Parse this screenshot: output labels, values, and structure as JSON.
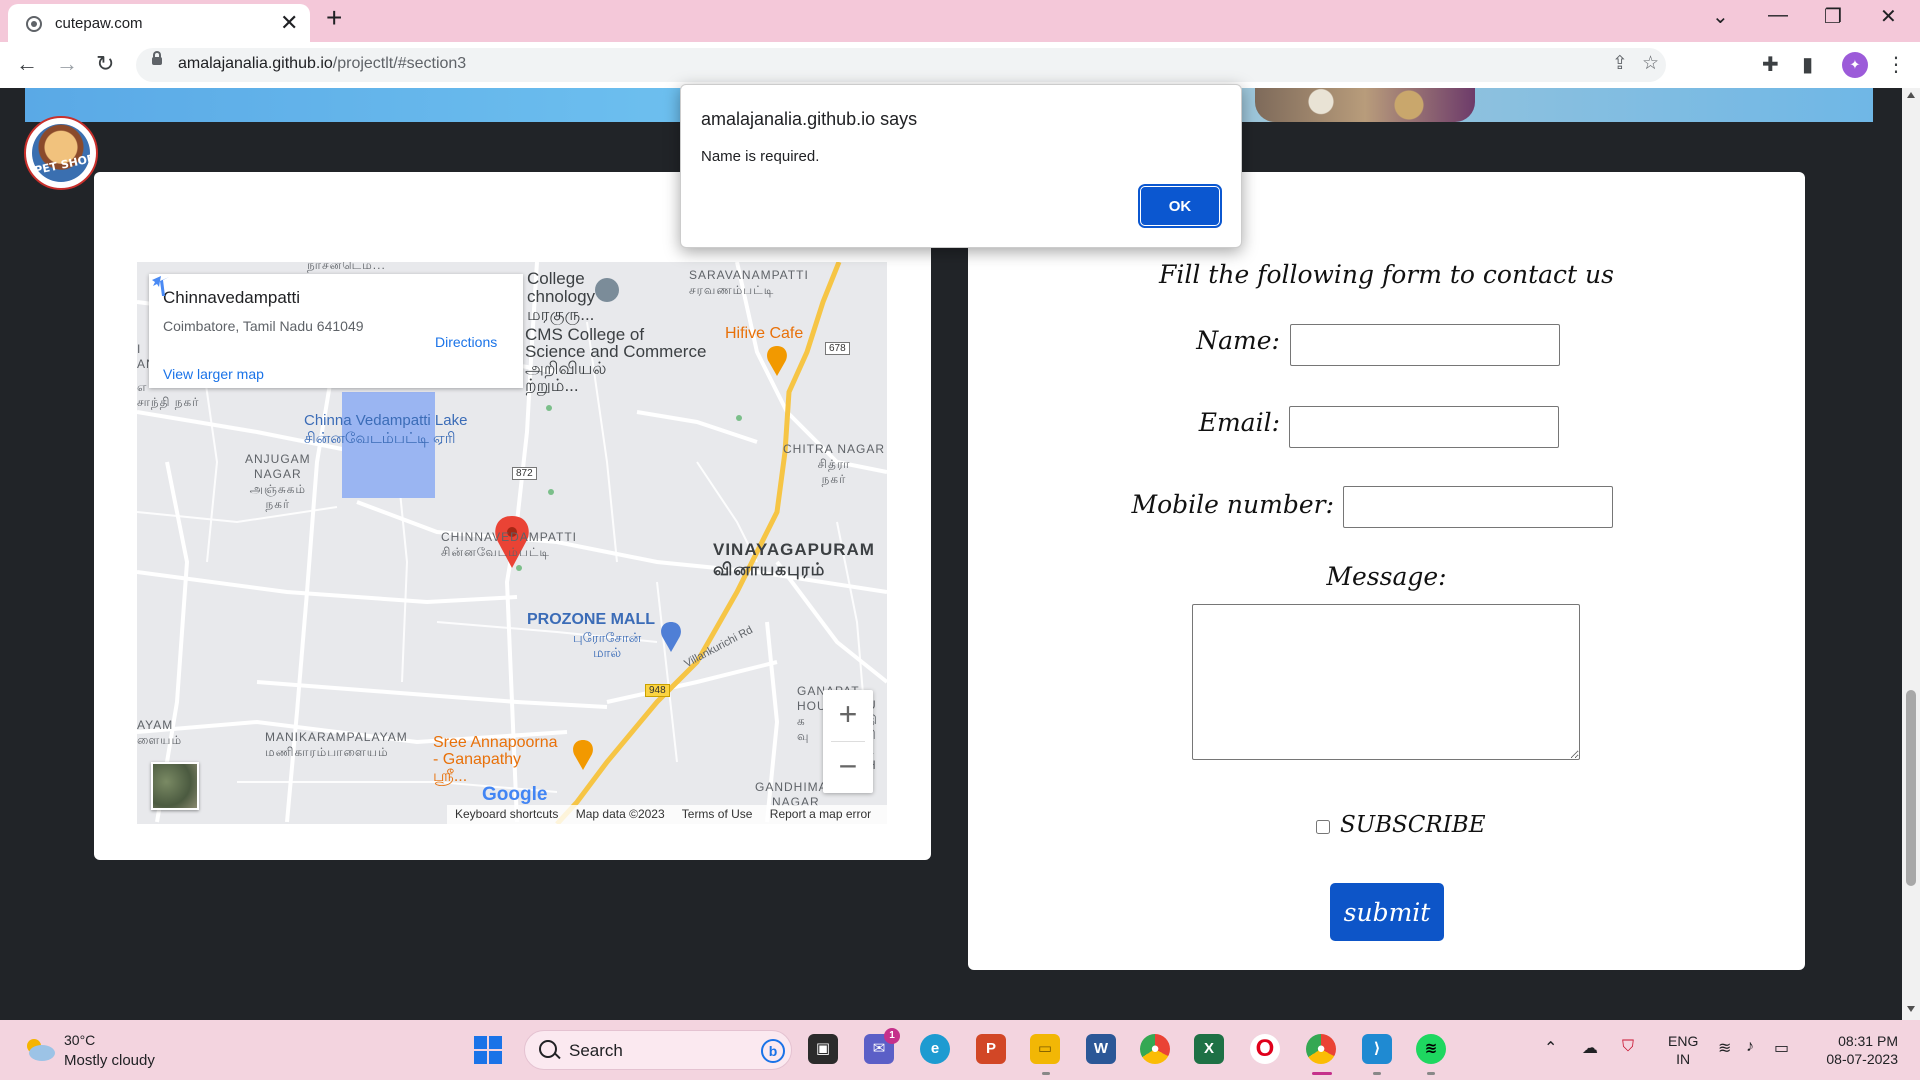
{
  "browser": {
    "tab_title": "cutepaw.com",
    "tab_close": "✕",
    "new_tab": "+",
    "url_domain": "amalajanalia.github.io",
    "url_path": "/projectlt/#section3",
    "window_controls": [
      "⌄",
      "—",
      "❐",
      "✕"
    ]
  },
  "logo": {
    "text": "PET SHOP"
  },
  "map": {
    "place_name": "Chinnavedampatti",
    "address": "Coimbatore, Tamil Nadu 641049",
    "directions_label": "Directions",
    "larger_map_link": "View larger map",
    "labels": {
      "saravanampatti": "SARAVANAMPATTI\nசரவணம்பட்டி",
      "college": "College\nchnology\nமரகுரு...",
      "cms": "CMS College of\nScience and Commerce\nஅறிவியல்\nற்றும்...",
      "hifive": "Hifive Cafe",
      "lake": "Chinna Vedampatti Lake\nசின்னவேடம்பட்டி ஏரி",
      "anjugam": "ANJUGAM\nNAGAR\nஅஞ்சுகம்\nநகர்",
      "chitra": "CHITRA NAGAR\nசித்ரா\nநகர்",
      "chinnavedampatti": "CHINNAVEDAMPATTI\nசின்னவேடம்பட்டி",
      "vinayagapuram": "VINAYAGAPURAM\nவினாயகபுரம்",
      "prozone": "PROZONE MALL",
      "prozone_ta": "புரோசோன்\nமால்",
      "villankurichi": "Villankurichi Rd",
      "ganapathy_hou": "GANAPAT\nHOU\nக\nவு",
      "ayam": "AYAM\nளையம்",
      "manikarampalayam": "MANIKARAMPALAYAM\nமணிகாரம்பாளையம்",
      "annapoorna": "Sree Annapoorna\n- Ganapathy\nஸ்ரீ...",
      "gandhimaa": "GANDHIMAA\nNAGAR",
      "santhi": "எ\nசாந்தி நகர்",
      "an": "I\nAN",
      "top_left": "நாசன்டெம்...",
      "r678": "678",
      "r872": "872",
      "r948": "948",
      "right_chars": "U\nதி\nரி\nL\nH"
    },
    "google_logo": "Google",
    "zoom_in": "+",
    "zoom_out": "−",
    "attribution": [
      "Keyboard shortcuts",
      "Map data ©2023",
      "Terms of Use",
      "Report a map error"
    ]
  },
  "form": {
    "heading": "Fill the following form to contact us",
    "name_label": "Name:",
    "email_label": "Email:",
    "mobile_label": "Mobile number:",
    "message_label": "Message:",
    "name_value": "",
    "email_value": "",
    "mobile_value": "",
    "message_value": "",
    "subscribe_label": "SUBSCRIBE",
    "subscribe_checked": false,
    "submit_label": "submit"
  },
  "dialog": {
    "title": "amalajanalia.github.io says",
    "message": "Name is required.",
    "ok_label": "OK"
  },
  "taskbar": {
    "temperature": "30°C",
    "weather": "Mostly cloudy",
    "search_label": "Search",
    "teams_badge": "1",
    "language": "ENG",
    "region": "IN",
    "time": "08:31 PM",
    "date": "08-07-2023"
  },
  "colors": {
    "page_bg": "#212428",
    "submit_bg": "#0d55c8",
    "dialog_ok": "#0b57d0",
    "taskbar_bg": "#f3d4df",
    "tabbar_bg": "#f4c8d9"
  }
}
